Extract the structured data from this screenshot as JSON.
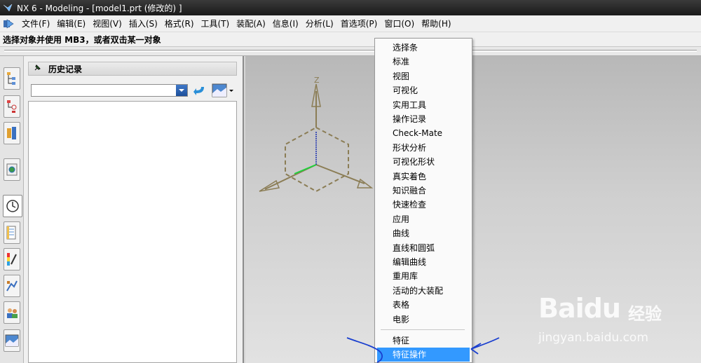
{
  "window": {
    "title": "NX 6 - Modeling - [model1.prt  (修改的) ]"
  },
  "menubar": {
    "items": [
      "文件(F)",
      "编辑(E)",
      "视图(V)",
      "插入(S)",
      "格式(R)",
      "工具(T)",
      "装配(A)",
      "信息(I)",
      "分析(L)",
      "首选项(P)",
      "窗口(O)",
      "帮助(H)"
    ]
  },
  "status": {
    "prompt": "选择对象并使用 MB3，或者双击某一对象"
  },
  "navigator": {
    "title": "历史记录",
    "combo_value": ""
  },
  "context_menu": {
    "items": [
      "选择条",
      "标准",
      "视图",
      "可视化",
      "实用工具",
      "操作记录",
      "Check-Mate",
      "形状分析",
      "可视化形状",
      "真实着色",
      "知识融合",
      "快速检查",
      "应用",
      "曲线",
      "直线和圆弧",
      "编辑曲线",
      "重用库",
      "活动的大装配",
      "表格",
      "电影"
    ],
    "items_after_separator": [
      "特征",
      "特征操作"
    ],
    "highlighted": "特征操作"
  },
  "triad": {
    "z_label": "Z"
  },
  "watermark": {
    "logo": "Baidu",
    "text": "经验",
    "url": "jingyan.baidu.com"
  },
  "colors": {
    "highlight": "#3399ff",
    "annotation": "#1a3fcf",
    "triad": "#8b7d55"
  }
}
